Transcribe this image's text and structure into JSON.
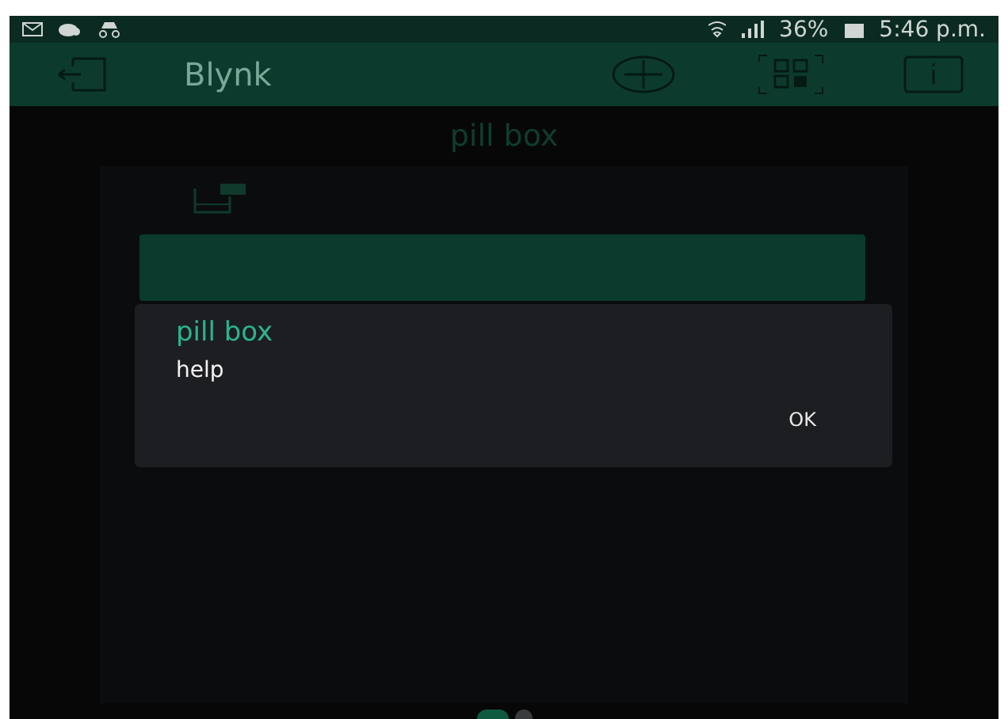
{
  "status_bar": {
    "battery": "36%",
    "time": "5:46 p.m."
  },
  "app_bar": {
    "title": "Blynk"
  },
  "project": {
    "title": "pill box"
  },
  "dialog": {
    "title": "pill box",
    "message": "help",
    "button": "OK"
  },
  "page_dots": [
    {
      "selected": true
    },
    {
      "selected": false
    }
  ]
}
